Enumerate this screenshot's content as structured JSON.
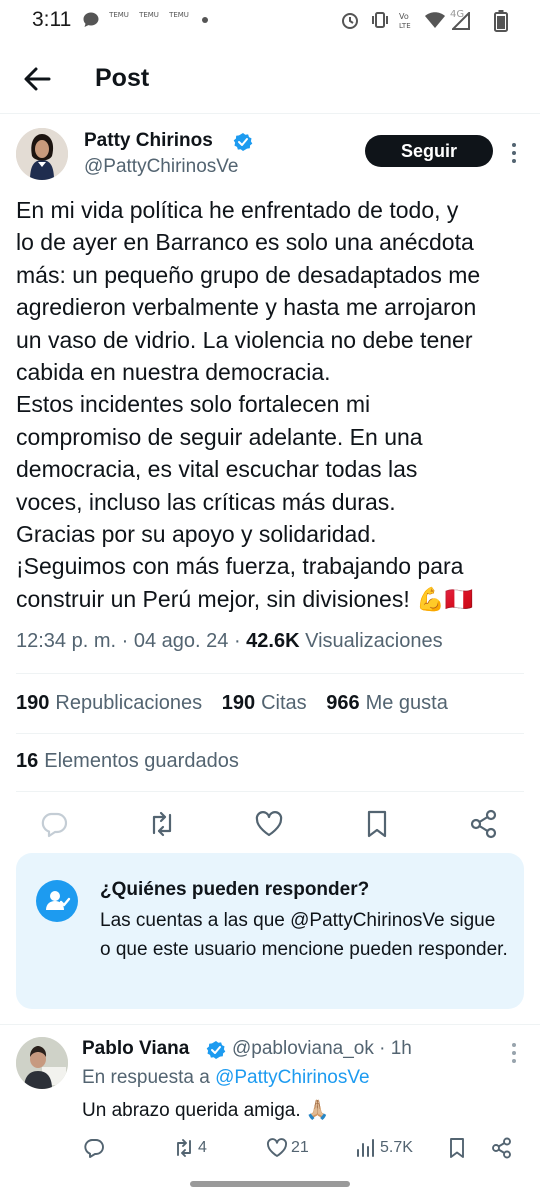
{
  "status_bar": {
    "time": "3:11",
    "app_badges": [
      "TEMU",
      "TEMU",
      "TEMU"
    ],
    "network_label": "4G"
  },
  "header": {
    "title": "Post"
  },
  "post": {
    "author": {
      "name": "Patty Chirinos",
      "handle": "@PattyChirinosVe",
      "verified": true
    },
    "follow_label": "Seguir",
    "text_lines": [
      "En mi vida política he enfrentado de todo, y",
      "lo de ayer en Barranco es solo una anécdota",
      "más: un pequeño grupo de desadaptados me",
      "agredieron verbalmente y hasta me arrojaron",
      "un vaso de vidrio. La violencia no debe tener",
      "cabida en nuestra democracia.",
      "Estos incidentes solo fortalecen mi",
      "compromiso de seguir adelante. En una",
      "democracia, es vital escuchar todas las",
      "voces, incluso las críticas más duras.",
      "Gracias por su apoyo y solidaridad.",
      "¡Seguimos con más fuerza, trabajando para",
      "construir un Perú mejor, sin divisiones! 💪🇵🇪"
    ],
    "time": "12:34 p. m.",
    "date": "04 ago. 24",
    "views_count": "42.6K",
    "views_label": "Visualizaciones",
    "reposts_count": "190",
    "reposts_label": "Republicaciones",
    "quotes_count": "190",
    "quotes_label": "Citas",
    "likes_count": "966",
    "likes_label": "Me gusta",
    "bookmarks_count": "16",
    "bookmarks_label": "Elementos guardados"
  },
  "reply_restriction": {
    "title": "¿Quiénes pueden responder?",
    "description": "Las cuentas a las que @PattyChirinosVe sigue o que este usuario mencione pueden responder."
  },
  "reply": {
    "author_name": "Pablo Viana",
    "verified": true,
    "handle_time": "@pabloviana_ok · 1h",
    "reply_to_prefix": "En respuesta a",
    "reply_to_handle": "@PattyChirinosVe",
    "text": "Un abrazo querida amiga. 🙏🏼",
    "retweets": "4",
    "likes": "21",
    "views": "5.7K"
  },
  "colors": {
    "accent": "#1d9bf0",
    "text": "#0f1419",
    "secondary_text": "#536471",
    "reply_box_bg": "#e8f5fd",
    "follow_button_bg": "#0f1419"
  }
}
